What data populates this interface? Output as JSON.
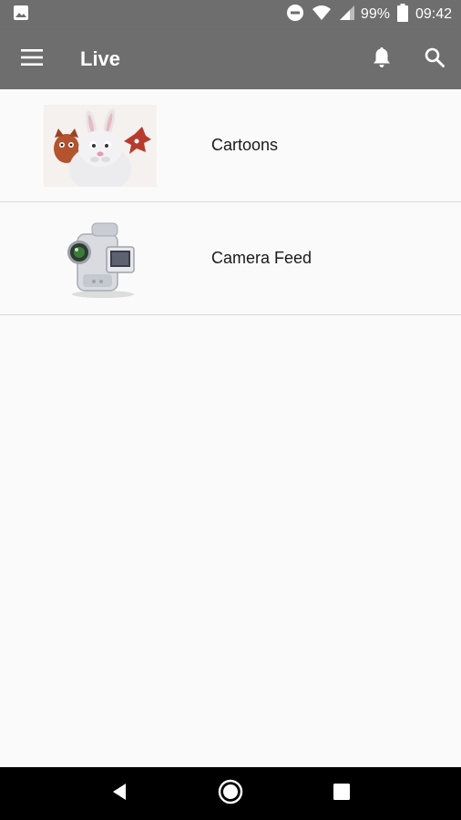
{
  "status_bar": {
    "battery_percent": "99%",
    "time": "09:42",
    "icons": [
      "image-notification-icon",
      "do-not-disturb-icon",
      "wifi-icon",
      "cell-signal-icon",
      "battery-icon"
    ]
  },
  "app_bar": {
    "title": "Live",
    "icons": [
      "menu-icon",
      "bell-icon",
      "search-icon"
    ]
  },
  "channels": [
    {
      "label": "Cartoons",
      "thumbnail": "cartoon-bunny-thumbnail"
    },
    {
      "label": "Camera Feed",
      "thumbnail": "camcorder-icon"
    }
  ],
  "nav_bar": {
    "icons": [
      "back-icon",
      "home-icon",
      "recents-icon"
    ]
  },
  "colors": {
    "app_bar": "#6e6e6e",
    "background": "#fafafa",
    "divider": "#d9d9d9",
    "nav_bar": "#000000"
  }
}
